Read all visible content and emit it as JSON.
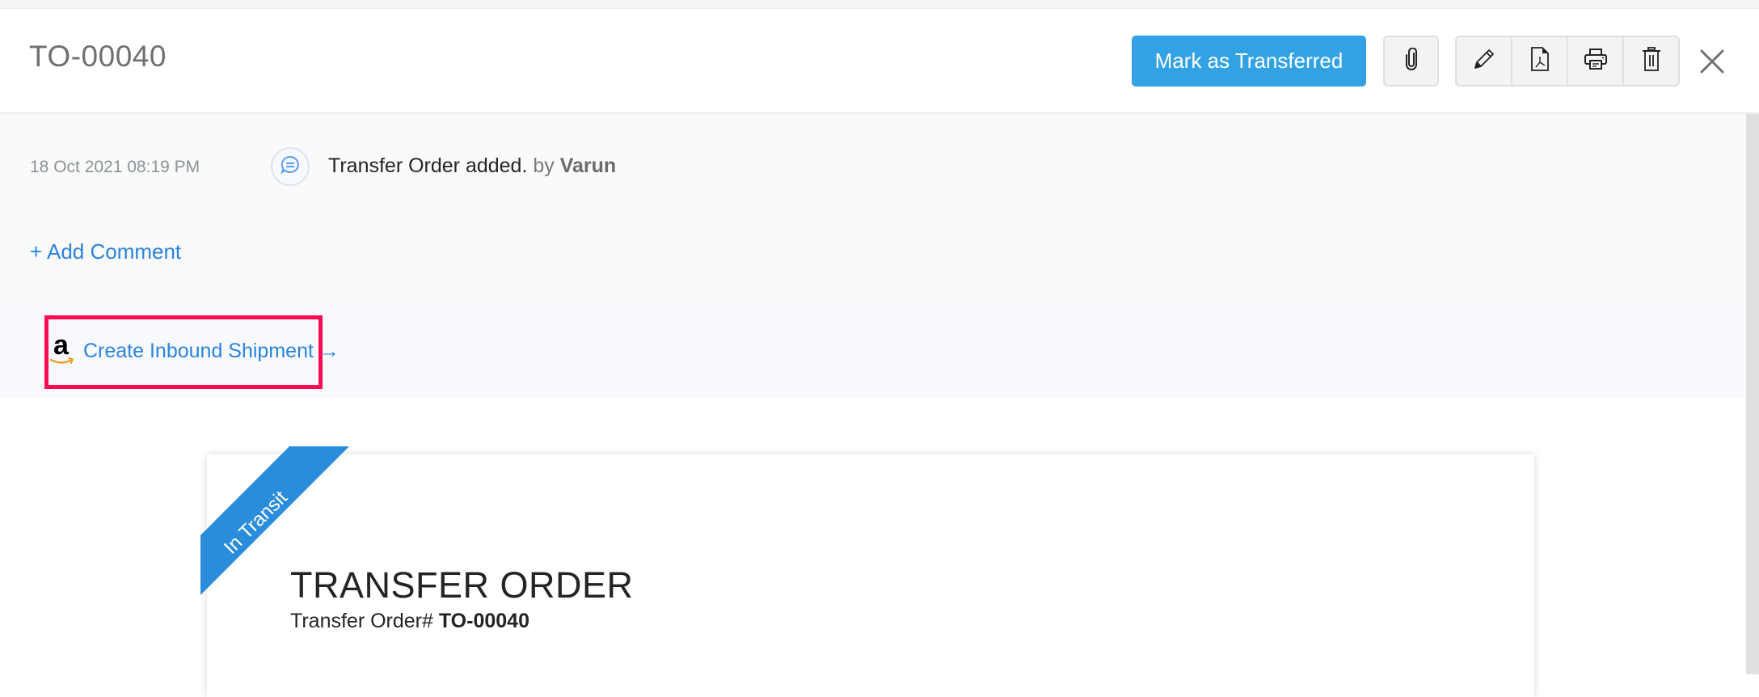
{
  "header": {
    "title": "TO-00040",
    "primary_action_label": "Mark as Transferred",
    "icons": {
      "attach": "paperclip-icon",
      "edit": "pencil-icon",
      "pdf": "pdf-file-icon",
      "print": "printer-icon",
      "delete": "trash-icon",
      "close": "close-icon"
    }
  },
  "activity": {
    "timestamp": "18 Oct 2021 08:19 PM",
    "icon": "comment-icon",
    "message": "Transfer Order added.",
    "by_label": "by",
    "user": "Varun",
    "add_comment_label": "+ Add Comment"
  },
  "amazon": {
    "icon": "amazon-logo-icon",
    "link_label": "Create Inbound Shipment",
    "arrow": "→"
  },
  "document": {
    "status_ribbon": "In Transit",
    "title": "TRANSFER ORDER",
    "number_label": "Transfer Order#",
    "number_value": "TO-00040"
  },
  "colors": {
    "primary_button": "#33a2e5",
    "link": "#2a83dd",
    "ribbon": "#2a8ddc",
    "highlight": "#ff0a53"
  }
}
